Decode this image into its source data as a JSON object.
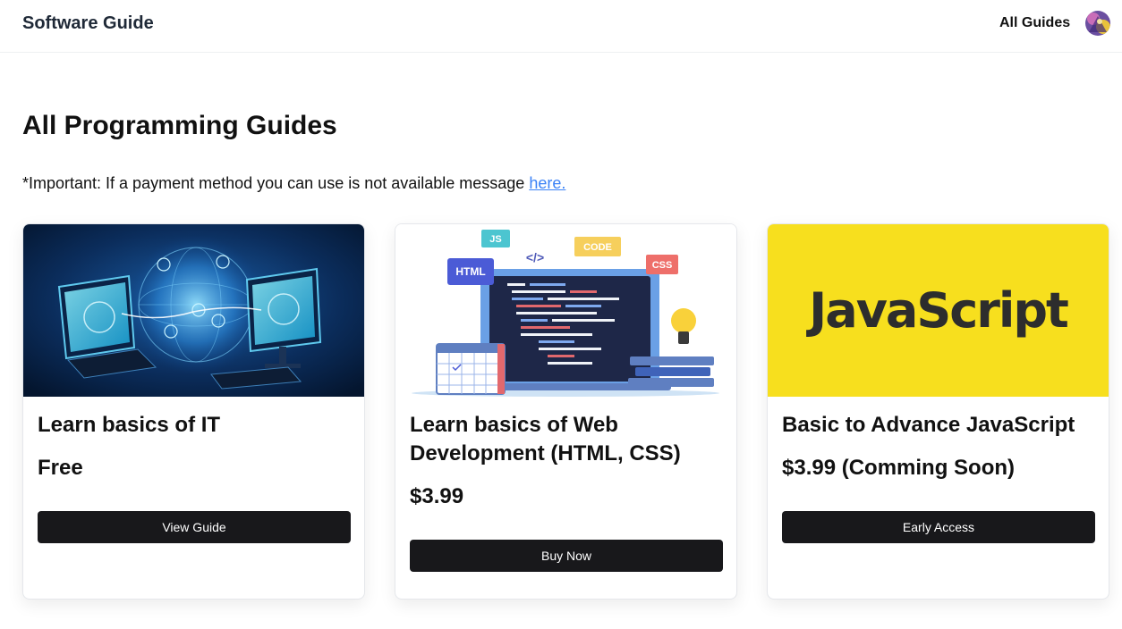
{
  "header": {
    "brand": "Software Guide",
    "nav_all_guides": "All Guides"
  },
  "main": {
    "title": "All Programming Guides",
    "notice_text": "*Important: If a payment method you can use is not available message ",
    "notice_link": "here."
  },
  "cards": [
    {
      "title": "Learn basics of IT",
      "price": "Free",
      "button": "View Guide",
      "image_icon": "network-globe-illustration"
    },
    {
      "title": "Learn basics of Web Development (HTML, CSS)",
      "price": "$3.99",
      "button": "Buy Now",
      "image_icon": "web-dev-laptop-illustration",
      "image_labels": {
        "js": "JS",
        "code": "CODE",
        "html": "HTML",
        "css": "CSS",
        "tag": "</>"
      }
    },
    {
      "title": "Basic to Advance JavaScript",
      "price": "$3.99 (Comming Soon)",
      "button": "Early Access",
      "image_icon": "javascript-logo",
      "image_logo_text": "JavaScript"
    }
  ],
  "colors": {
    "accent_link": "#3b82f6",
    "button_bg": "#18181b",
    "js_yellow": "#f7df1e"
  }
}
